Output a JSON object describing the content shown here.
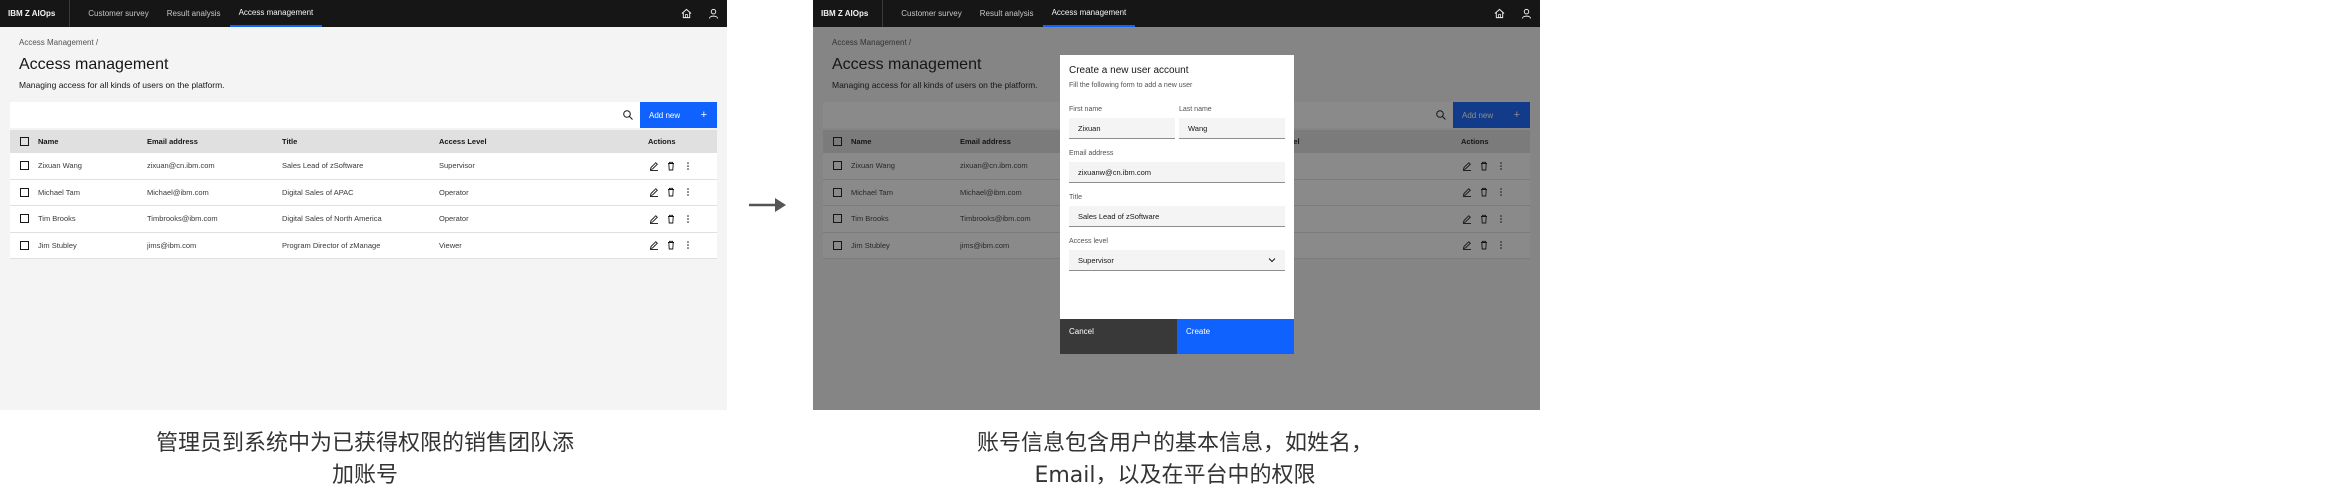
{
  "app": {
    "brand_prefix": "IBM",
    "brand_name": "Z AIOps",
    "nav": [
      "Customer survey",
      "Result analysis",
      "Access management"
    ],
    "active_nav": "Access management",
    "icons": [
      "home-icon",
      "user-icon"
    ]
  },
  "page": {
    "breadcrumb": "Access Management  /",
    "title": "Access management",
    "subtitle": "Managing access for all kinds of users on the platform.",
    "add_button": "Add new",
    "add_icon": "+"
  },
  "table": {
    "columns": [
      "Name",
      "Email address",
      "Title",
      "Access Level",
      "Actions"
    ],
    "rows": [
      {
        "name": "Zixuan Wang",
        "email": "zixuan@cn.ibm.com",
        "title": "Sales Lead of zSoftware",
        "level": "Supervisor"
      },
      {
        "name": "Michael Tam",
        "email": "Michael@ibm.com",
        "title": "Digital Sales of APAC",
        "level": "Operator"
      },
      {
        "name": "Tim Brooks",
        "email": "Timbrooks@ibm.com",
        "title": "Digital Sales of North America",
        "level": "Operator"
      },
      {
        "name": "Jim Stubley",
        "email": "jims@ibm.com",
        "title": "Program Director of zManage",
        "level": "Viewer"
      }
    ]
  },
  "modal": {
    "title": "Create a new user account",
    "subtitle": "Fill the following form to add a new user",
    "first_name_label": "First name",
    "first_name_value": "Zixuan",
    "last_name_label": "Last name",
    "last_name_value": "Wang",
    "email_label": "Email address",
    "email_value": "zixuanw@cn.ibm.com",
    "title_label": "Title",
    "title_value": "Sales Lead of zSoftware",
    "access_label": "Access level",
    "access_value": "Supervisor",
    "cancel": "Cancel",
    "create": "Create"
  },
  "captions": {
    "left": "管理员到系统中为已获得权限的销售团队添加账号",
    "right": "账号信息包含用户的基本信息，如姓名，Email，以及在平台中的权限"
  },
  "colors": {
    "primary": "#0f62fe",
    "header_bg": "#161616",
    "page_bg": "#f4f4f4"
  }
}
